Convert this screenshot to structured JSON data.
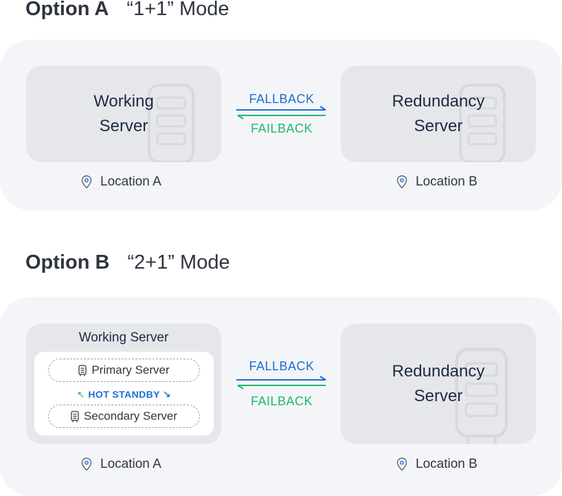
{
  "option_a": {
    "title": "Option A",
    "mode": "“1+1” Mode",
    "working_server": [
      "Working",
      "Server"
    ],
    "redundancy_server": [
      "Redundancy",
      "Server"
    ],
    "fallback": "FALLBACK",
    "failback": "FAILBACK",
    "location_a": "Location A",
    "location_b": "Location B"
  },
  "option_b": {
    "title": "Option B",
    "mode": "“2+1” Mode",
    "working_server_title": "Working Server",
    "primary_server": "Primary Server",
    "hot_standby": "HOT STANDBY",
    "secondary_server": "Secondary Server",
    "redundancy_server": [
      "Redundancy",
      "Server"
    ],
    "fallback": "FALLBACK",
    "failback": "FAILBACK",
    "location_a": "Location A",
    "location_b": "Location B"
  },
  "icons": [
    "server-rack-icon",
    "location-pin-icon",
    "arrow-right-icon",
    "arrow-left-icon"
  ],
  "colors": {
    "fallback": "#1b6fd1",
    "failback": "#20b86a",
    "panel_bg": "#f4f5f8",
    "box_bg": "#e6e7ea"
  }
}
